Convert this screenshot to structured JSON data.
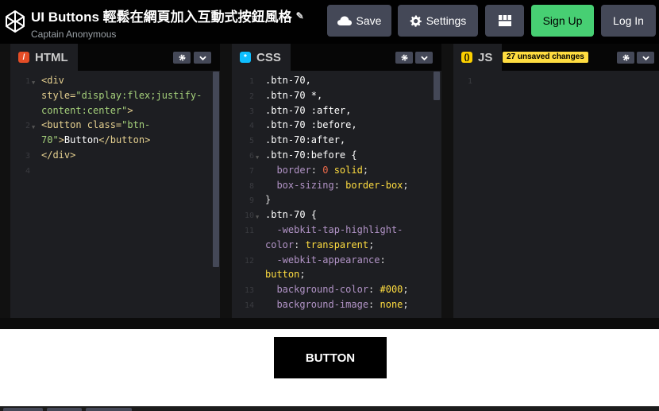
{
  "header": {
    "title": "UI Buttons 輕鬆在網頁加入互動式按鈕風格",
    "author": "Captain Anonymous",
    "buttons": {
      "save": "Save",
      "settings": "Settings",
      "signup": "Sign Up",
      "login": "Log In"
    }
  },
  "panes": {
    "html": {
      "label": "HTML",
      "line_numbers": [
        "1",
        "",
        "",
        "2",
        "",
        "3",
        "4"
      ],
      "folded": [
        true,
        false,
        false,
        true,
        false,
        false,
        false
      ],
      "lines": [
        [
          {
            "t": "<div",
            "c": "c-tag"
          }
        ],
        [
          {
            "t": "style=",
            "c": "c-attr"
          },
          {
            "t": "\"display:flex;justify-",
            "c": "c-str"
          }
        ],
        [
          {
            "t": "content:center\"",
            "c": "c-str"
          },
          {
            "t": ">",
            "c": "c-tag"
          }
        ],
        [
          {
            "t": "<button ",
            "c": "c-tag"
          },
          {
            "t": "class=",
            "c": "c-attr"
          },
          {
            "t": "\"btn-",
            "c": "c-str"
          }
        ],
        [
          {
            "t": "70\"",
            "c": "c-str"
          },
          {
            "t": ">",
            "c": "c-tag"
          },
          {
            "t": "Button",
            "c": "c-txt"
          },
          {
            "t": "</button>",
            "c": "c-tag"
          }
        ],
        [
          {
            "t": "</div>",
            "c": "c-tag"
          }
        ],
        []
      ]
    },
    "css": {
      "label": "CSS",
      "line_numbers": [
        "1",
        "2",
        "3",
        "4",
        "5",
        "6",
        "7",
        "8",
        "9",
        "10",
        "11",
        "",
        "12",
        "",
        "13",
        "14"
      ],
      "folded": [
        false,
        false,
        false,
        false,
        false,
        true,
        false,
        false,
        false,
        true,
        false,
        false,
        false,
        false,
        false,
        false
      ],
      "lines": [
        [
          {
            "t": ".btn-70,",
            "c": "c-sel"
          }
        ],
        [
          {
            "t": ".btn-70 *,",
            "c": "c-sel"
          }
        ],
        [
          {
            "t": ".btn-70 :after,",
            "c": "c-sel"
          }
        ],
        [
          {
            "t": ".btn-70 :before,",
            "c": "c-sel"
          }
        ],
        [
          {
            "t": ".btn-70:after,",
            "c": "c-sel"
          }
        ],
        [
          {
            "t": ".btn-70:before {",
            "c": "c-sel"
          }
        ],
        [
          {
            "t": "  border",
            "c": "c-prop"
          },
          {
            "t": ": ",
            "c": "c-punc"
          },
          {
            "t": "0",
            "c": "c-num"
          },
          {
            "t": " solid",
            "c": "c-val"
          },
          {
            "t": ";",
            "c": "c-punc"
          }
        ],
        [
          {
            "t": "  box-sizing",
            "c": "c-prop"
          },
          {
            "t": ": ",
            "c": "c-punc"
          },
          {
            "t": "border-box",
            "c": "c-val"
          },
          {
            "t": ";",
            "c": "c-punc"
          }
        ],
        [
          {
            "t": "}",
            "c": "c-punc"
          }
        ],
        [
          {
            "t": ".btn-70 {",
            "c": "c-sel"
          }
        ],
        [
          {
            "t": "  -webkit-tap-highlight-",
            "c": "c-prop"
          }
        ],
        [
          {
            "t": "color",
            "c": "c-prop"
          },
          {
            "t": ": ",
            "c": "c-punc"
          },
          {
            "t": "transparent",
            "c": "c-val"
          },
          {
            "t": ";",
            "c": "c-punc"
          }
        ],
        [
          {
            "t": "  -webkit-appearance",
            "c": "c-prop"
          },
          {
            "t": ":",
            "c": "c-punc"
          }
        ],
        [
          {
            "t": "button",
            "c": "c-val"
          },
          {
            "t": ";",
            "c": "c-punc"
          }
        ],
        [
          {
            "t": "  background-color",
            "c": "c-prop"
          },
          {
            "t": ": ",
            "c": "c-punc"
          },
          {
            "t": "#000",
            "c": "c-val"
          },
          {
            "t": ";",
            "c": "c-punc"
          }
        ],
        [
          {
            "t": "  background-image",
            "c": "c-prop"
          },
          {
            "t": ": ",
            "c": "c-punc"
          },
          {
            "t": "none",
            "c": "c-val"
          },
          {
            "t": ";",
            "c": "c-punc"
          }
        ]
      ]
    },
    "js": {
      "label": "JS",
      "badge": "27 unsaved changes",
      "line_numbers": [
        "1"
      ],
      "folded": [
        false
      ],
      "lines": [
        []
      ]
    }
  },
  "preview": {
    "button_label": "BUTTON"
  },
  "icons": {
    "logo": "codepen-logo-icon",
    "save": "cloud-icon",
    "settings": "gear-icon",
    "layout": "layout-grid-icon",
    "edit": "pencil-icon",
    "pane_settings": "gear-icon",
    "pane_menu": "chevron-down-icon"
  },
  "colors": {
    "signup": "#47cf73",
    "button_bg": "#444857",
    "badge": "#ffdd40",
    "html_icon": "#e44d26",
    "css_icon": "#0ebeff",
    "js_icon": "#fcd000"
  }
}
